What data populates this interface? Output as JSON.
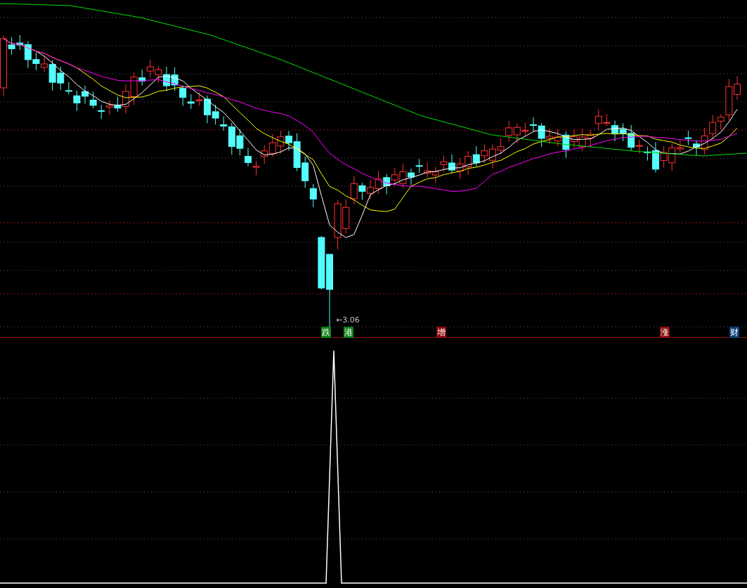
{
  "signals": [
    {
      "label": "跌",
      "color": "#0b7f14"
    },
    {
      "label": "港",
      "color": "#0b7f14"
    },
    {
      "label": "增",
      "color": "#8a0a0a"
    },
    {
      "label": "涨",
      "color": "#8a0a0a"
    },
    {
      "label": "财",
      "color": "#0b3f75"
    }
  ],
  "low_marker": "←3.06"
}
